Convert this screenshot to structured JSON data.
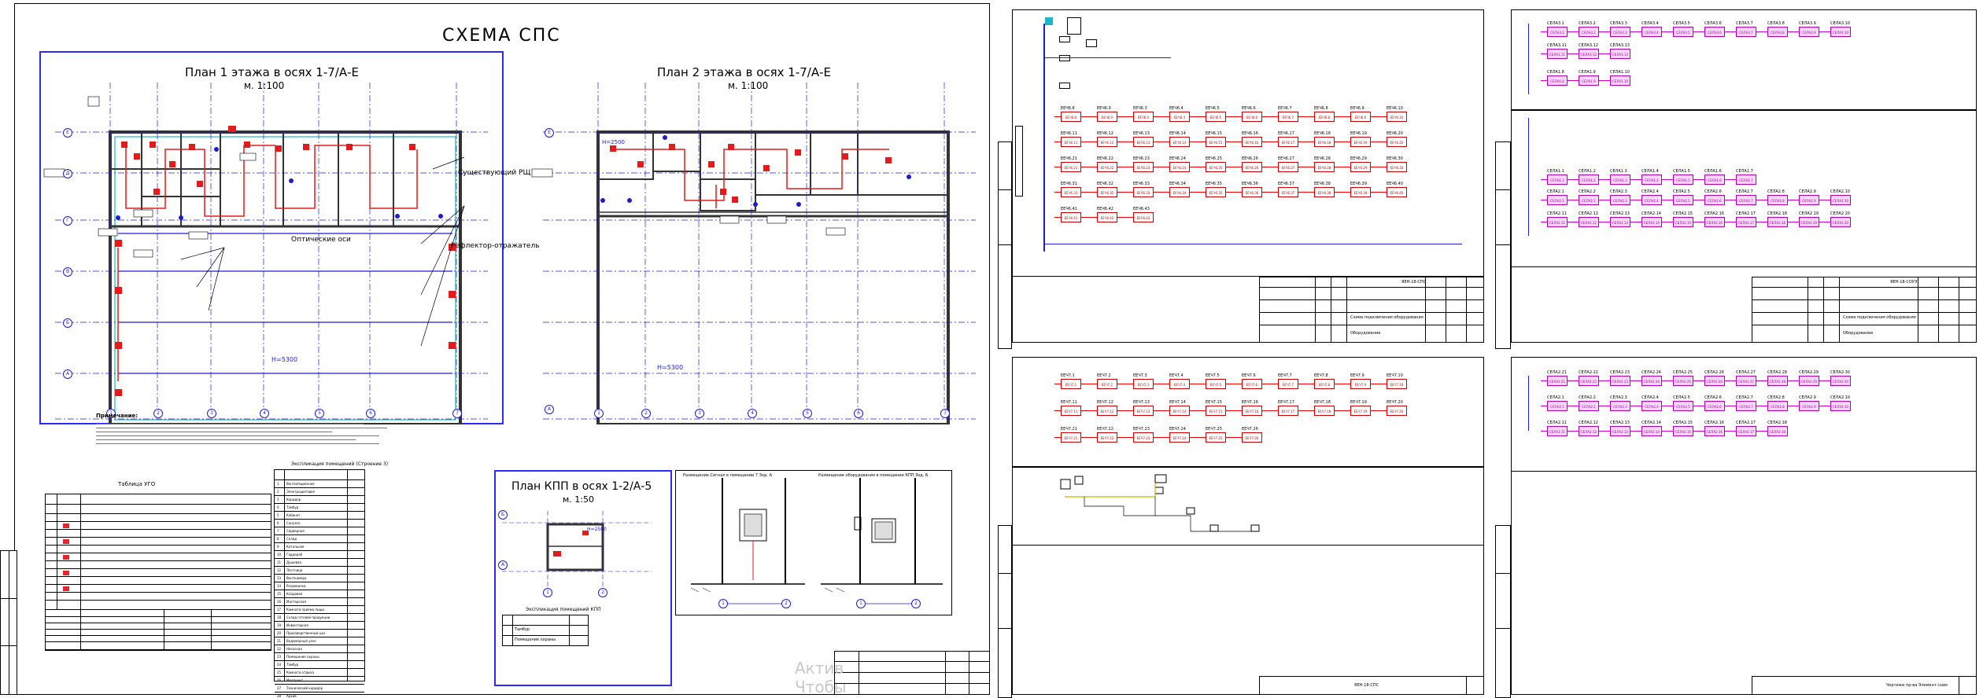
{
  "left_sheet": {
    "title": "СХЕМА СПС",
    "plan1": {
      "title": "План 1 этажа в осях 1-7/А-Е",
      "scale": "м. 1:100",
      "h_label": "Н=5300"
    },
    "plan2": {
      "title": "План 2 этажа в осях 1-7/А-Е",
      "scale": "м. 1:100",
      "h_label": "Н=5300",
      "h2_label": "Н=2500"
    },
    "callouts": [
      "Существующий РЩ СН",
      "Оптические оси",
      "Рефлектор-отражатель"
    ],
    "axis_letters": [
      "А",
      "Б",
      "В",
      "Г",
      "Д",
      "Е"
    ],
    "axis_numbers": [
      "1",
      "2",
      "3",
      "4",
      "5",
      "6",
      "7"
    ],
    "notes_title": "Примечание:",
    "legend_title": "Таблица УГО",
    "explication_title": "Экспликация помещений (Строение 3)",
    "kpp": {
      "title": "План КПП в осях 1-2/А-5",
      "scale": "м. 1:50",
      "explication_title": "Экспликация помещений КПП",
      "rooms": [
        "Тамбур",
        "Помещение охраны"
      ]
    },
    "section1_title": "Размещение Сигнал в помещении 7 Зод. А",
    "section2_title": "Размещение оборудования в помещении КПП Зод. Б",
    "watermark": "Актив Чтобы",
    "rooms": [
      "Вентиляционная",
      "Электрощитовая",
      "Коридор",
      "Тамбур",
      "Кабинет",
      "Санузел",
      "Серверная",
      "Склад",
      "Котельная",
      "Гардероб",
      "Душевая",
      "Лестница",
      "Венткамера",
      "Раздевалка",
      "Кладовая",
      "Мастерская",
      "Комната приема пищи",
      "Склад готовой продукции",
      "Инвентарная",
      "Производственный цех",
      "Водомерный узел",
      "Насосная",
      "Помещение охраны",
      "Тамбур",
      "Комната отдыха",
      "Медпункт",
      "Технический коридор",
      "Архив"
    ]
  },
  "sheet_a": {
    "title_doc": "Схема подключения оборудования",
    "code": "ЯЕН-18-СПС",
    "equipment": "Оборудование",
    "rows": [
      [
        "ЕЕЧ6.8",
        "ЕЕЧ6.9",
        "ЕЕЧ6.3",
        "ЕЕЧ6.4",
        "ЕЕЧ6.5",
        "ЕЕЧ6.6",
        "ЕЕЧ6.7",
        "ЕЕЧ6.8",
        "ЕЕЧ6.9",
        "ЕЕЧ6.10"
      ],
      [
        "ЕЕЧ6.11",
        "ЕЕЧ6.12",
        "ЕЕЧ6.13",
        "ЕЕЧ6.14",
        "ЕЕЧ6.15",
        "ЕЕЧ6.16",
        "ЕЕЧ6.17",
        "ЕЕЧ6.18",
        "ЕЕЧ6.19",
        "ЕЕЧ6.20"
      ],
      [
        "ЕЕЧ6.21",
        "ЕЕЧ6.22",
        "ЕЕЧ6.23",
        "ЕЕЧ6.24",
        "ЕЕЧ6.25",
        "ЕЕЧ6.26",
        "ЕЕЧ6.27",
        "ЕЕЧ6.28",
        "ЕЕЧ6.29",
        "ЕЕЧ6.30"
      ],
      [
        "ЕЕЧ6.31",
        "ЕЕЧ6.32",
        "ЕЕЧ6.33",
        "ЕЕЧ6.34",
        "ЕЕЧ6.35",
        "ЕЕЧ6.36",
        "ЕЕЧ6.37",
        "ЕЕЧ6.38",
        "ЕЕЧ6.39",
        "ЕЕЧ6.40"
      ],
      [
        "ЕЕЧ6.41",
        "ЕЕЧ6.42",
        "ЕЕЧ6.43"
      ]
    ]
  },
  "sheet_b": {
    "title_doc": "Схема подключения оборудования",
    "code": "ЯЕН-18-СОУЭ",
    "equipment": "Оборудование",
    "top_rows": [
      [
        "СЕЛА3.1",
        "СЕЛА3.2",
        "СЕЛА3.3",
        "СЕЛА3.4",
        "СЕЛА3.5",
        "СЕЛА3.6",
        "СЕЛА3.7",
        "СЕЛА3.8",
        "СЕЛА3.9",
        "СЕЛА3.10"
      ],
      [
        "СЕЛА3.11",
        "СЕЛА3.12",
        "СЕЛА3.13"
      ],
      [
        "СЕЛА1.8",
        "СЕЛА1.9",
        "СЕЛА1.10"
      ]
    ],
    "bottom_rows": [
      [
        "СЕЛА1.1",
        "СЕЛА1.2",
        "СЕЛА1.3",
        "СЕЛА1.4",
        "СЕЛА1.5",
        "СЕЛА1.6",
        "СЕЛА1.7"
      ],
      [
        "СЕЛА2.1",
        "СЕЛА2.2",
        "СЕЛА2.3",
        "СЕЛА2.4",
        "СЕЛА2.5",
        "СЕЛА2.6",
        "СЕЛА2.7",
        "СЕЛА2.8",
        "СЕЛА2.9",
        "СЕЛА2.10"
      ],
      [
        "СЕЛА2.11",
        "СЕЛА2.12",
        "СЕЛА2.13",
        "СЕЛА2.14",
        "СЕЛА2.15",
        "СЕЛА2.16",
        "СЕЛА2.17",
        "СЕЛА2.18",
        "СЕЛА2.19",
        "СЕЛА2.20"
      ]
    ]
  },
  "sheet_c": {
    "code": "ЯЕН-18-СПС",
    "rows": [
      [
        "ЕЕЧ7.1",
        "ЕЕЧ7.2",
        "ЕЕЧ7.3",
        "ЕЕЧ7.4",
        "ЕЕЧ7.5",
        "ЕЕЧ7.6",
        "ЕЕЧ7.7",
        "ЕЕЧ7.8",
        "ЕЕЧ7.9",
        "ЕЕЧ7.10"
      ],
      [
        "ЕЕЧ7.11",
        "ЕЕЧ7.12",
        "ЕЕЧ7.13",
        "ЕЕЧ7.14",
        "ЕЕЧ7.15",
        "ЕЕЧ7.16",
        "ЕЕЧ7.17",
        "ЕЕЧ7.18",
        "ЕЕЧ7.19",
        "ЕЕЧ7.20"
      ],
      [
        "ЕЕЧ7.21",
        "ЕЕЧ7.22",
        "ЕЕЧ7.23",
        "ЕЕЧ7.24",
        "ЕЕЧ7.25",
        "ЕЕЧ7.26"
      ]
    ]
  },
  "sheet_d": {
    "rows": [
      [
        "СЕЛА2.21",
        "СЕЛА2.22",
        "СЕЛА2.23",
        "СЕЛА2.24",
        "СЕЛА2.25",
        "СЕЛА2.26",
        "СЕЛА2.27",
        "СЕЛА2.28",
        "СЕЛА2.29",
        "СЕЛА2.30"
      ],
      [
        "СЕЛА2.1",
        "СЕЛА2.2",
        "СЕЛА2.3",
        "СЕЛА2.4",
        "СЕЛА2.5",
        "СЕЛА2.6",
        "СЕЛА2.7",
        "СЕЛА2.8",
        "СЕЛА2.9",
        "СЕЛА2.10"
      ],
      [
        "СЕЛА2.11",
        "СЕЛА2.12",
        "СЕЛА2.13",
        "СЕЛА2.14",
        "СЕЛА2.15",
        "СЕЛА2.16",
        "СЕЛА2.17",
        "СЕЛА2.18"
      ]
    ],
    "stamp": "Чертежи пр-ва Элемент схем"
  }
}
